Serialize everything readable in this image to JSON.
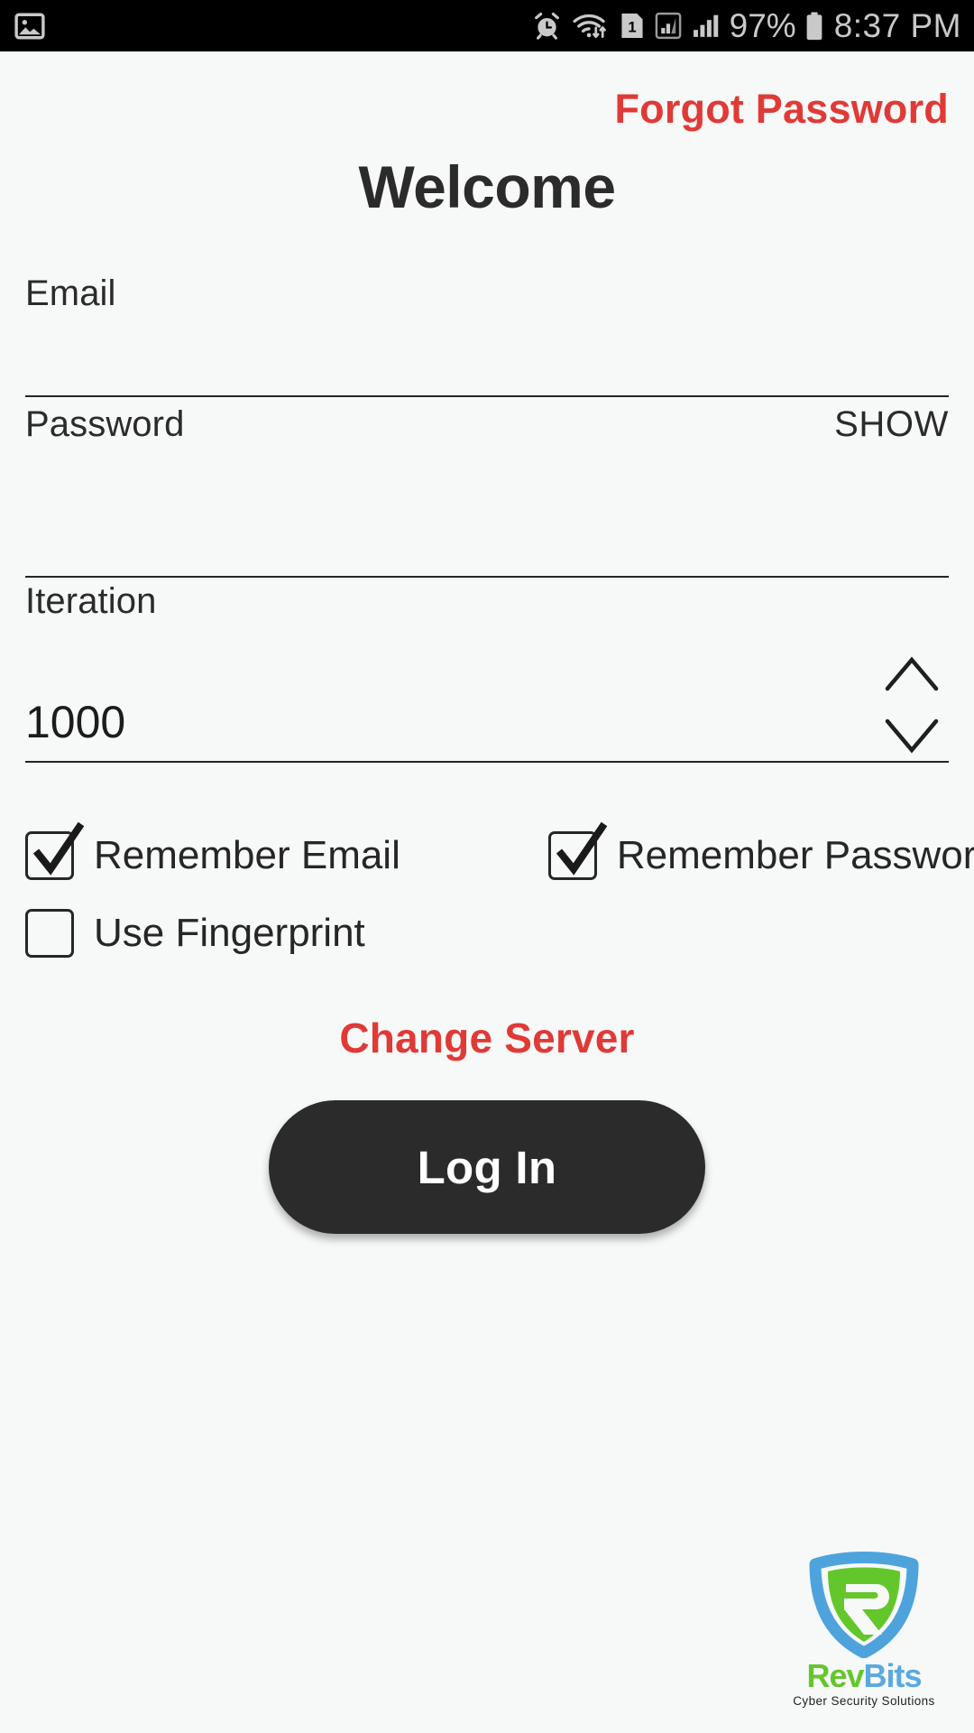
{
  "statusbar": {
    "time": "8:37 PM",
    "battery_percent": "97%",
    "icons": [
      "photo-icon",
      "alarm-icon",
      "wifi-transfer-icon",
      "sim-one-icon",
      "mobile-data-icon",
      "signal-bars-icon",
      "battery-icon"
    ]
  },
  "header": {
    "forgot_password": "Forgot Password",
    "title": "Welcome"
  },
  "form": {
    "email": {
      "label": "Email",
      "value": "",
      "placeholder": ""
    },
    "password": {
      "label": "Password",
      "value": "",
      "placeholder": "",
      "show_toggle": "SHOW"
    },
    "iteration": {
      "label": "Iteration",
      "value": "1000"
    }
  },
  "options": {
    "remember_email": {
      "label": "Remember Email",
      "checked": true
    },
    "remember_password": {
      "label": "Remember Password",
      "checked": true
    },
    "use_fingerprint": {
      "label": "Use Fingerprint",
      "checked": false
    }
  },
  "actions": {
    "change_server": "Change Server",
    "login": "Log In"
  },
  "branding": {
    "name_part1": "Rev",
    "name_part2": "Bits",
    "tagline": "Cyber Security Solutions"
  },
  "colors": {
    "accent_red": "#e03a36",
    "button_dark": "#2b2b2b",
    "background": "#f7f8f8",
    "logo_green": "#63c72b",
    "logo_blue": "#5aa9e0",
    "statusbar_bg": "#000000",
    "statusbar_fg": "#c9c9c9"
  }
}
